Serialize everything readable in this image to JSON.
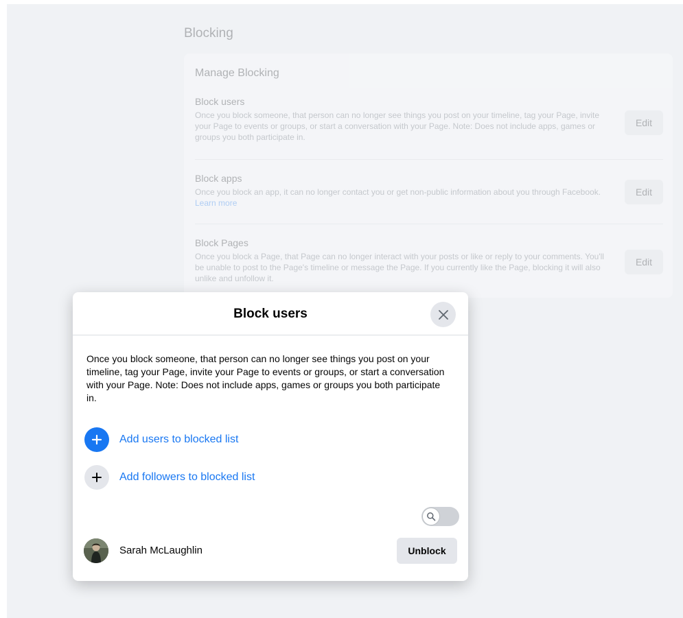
{
  "settings": {
    "section_title": "Blocking",
    "card_title": "Manage Blocking",
    "rows": [
      {
        "title": "Block users",
        "description": "Once you block someone, that person can no longer see things you post on your timeline, tag your Page, invite your Page to events or groups, or start a conversation with your Page. Note: Does not include apps, games or groups you both participate in.",
        "edit_label": "Edit"
      },
      {
        "title": "Block apps",
        "description": "Once you block an app, it can no longer contact you or get non-public information about you through Facebook.",
        "link": "Learn more",
        "edit_label": "Edit"
      },
      {
        "title": "Block Pages",
        "description": "Once you block a Page, that Page can no longer interact with your posts or like or reply to your comments. You'll be unable to post to the Page's timeline or message the Page. If you currently like the Page, blocking it will also unlike and unfollow it.",
        "edit_label": "Edit"
      }
    ]
  },
  "modal": {
    "title": "Block users",
    "description": "Once you block someone, that person can no longer see things you post on your timeline, tag your Page, invite your Page to events or groups, or start a conversation with your Page. Note: Does not include apps, games or groups you both participate in.",
    "add_users_label": "Add users to blocked list",
    "add_followers_label": "Add followers to blocked list",
    "blocked_users": [
      {
        "name": "Sarah McLaughlin",
        "action_label": "Unblock"
      }
    ]
  },
  "icons": {
    "close": "close-icon",
    "add_blue": "plus-icon",
    "add_grey": "plus-icon",
    "search": "search-icon"
  },
  "colors": {
    "accent": "#1877f2",
    "button_grey": "#e4e6eb",
    "background": "#f0f2f5"
  }
}
